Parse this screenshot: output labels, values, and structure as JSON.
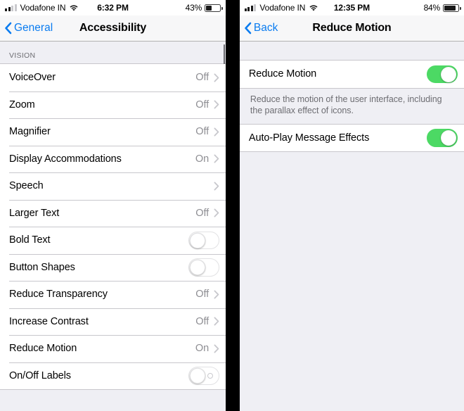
{
  "left_screen": {
    "status_bar": {
      "carrier": "Vodafone IN",
      "signal_bars_active": 2,
      "time": "6:32 PM",
      "battery_percent_label": "43%",
      "battery_level": 43
    },
    "nav": {
      "back_label": "General",
      "title": "Accessibility"
    },
    "section_header": "VISION",
    "rows": [
      {
        "label": "VoiceOver",
        "value": "Off",
        "type": "disclosure"
      },
      {
        "label": "Zoom",
        "value": "Off",
        "type": "disclosure"
      },
      {
        "label": "Magnifier",
        "value": "Off",
        "type": "disclosure"
      },
      {
        "label": "Display Accommodations",
        "value": "On",
        "type": "disclosure"
      },
      {
        "label": "Speech",
        "value": "",
        "type": "disclosure"
      },
      {
        "label": "Larger Text",
        "value": "Off",
        "type": "disclosure"
      },
      {
        "label": "Bold Text",
        "value": "",
        "type": "switch",
        "switch_on": false
      },
      {
        "label": "Button Shapes",
        "value": "",
        "type": "switch",
        "switch_on": false
      },
      {
        "label": "Reduce Transparency",
        "value": "Off",
        "type": "disclosure"
      },
      {
        "label": "Increase Contrast",
        "value": "Off",
        "type": "disclosure"
      },
      {
        "label": "Reduce Motion",
        "value": "On",
        "type": "disclosure"
      },
      {
        "label": "On/Off Labels",
        "value": "",
        "type": "switch-labeled",
        "switch_on": false
      }
    ]
  },
  "right_screen": {
    "status_bar": {
      "carrier": "Vodafone IN",
      "signal_bars_active": 3,
      "time": "12:35 PM",
      "battery_percent_label": "84%",
      "battery_level": 84
    },
    "nav": {
      "back_label": "Back",
      "title": "Reduce Motion"
    },
    "rows_group_1": [
      {
        "label": "Reduce Motion",
        "type": "switch",
        "switch_on": true
      }
    ],
    "footer_note": "Reduce the motion of the user interface, including the parallax effect of icons.",
    "rows_group_2": [
      {
        "label": "Auto-Play Message Effects",
        "type": "switch",
        "switch_on": true
      }
    ]
  },
  "colors": {
    "accent_blue": "#0a7cf0",
    "switch_on_green": "#4cd964",
    "value_gray": "#8e8e93",
    "group_bg": "#efeff4"
  }
}
